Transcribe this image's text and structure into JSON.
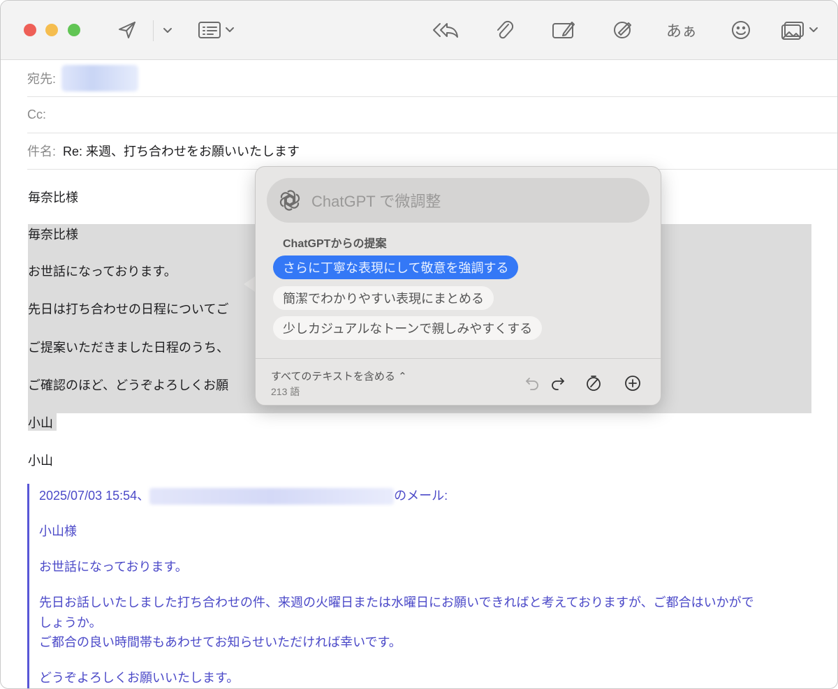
{
  "colors": {
    "accent": "#3478f6",
    "quote": "#4b49c8",
    "close": "#ee5f57",
    "minimize": "#f5bd4f",
    "zoom": "#61c554"
  },
  "toolbar": {
    "icons": [
      "send-icon",
      "send-options-chevron-icon",
      "header-fields-icon",
      "reply-all-icon",
      "attachment-icon",
      "new-message-icon",
      "markup-icon",
      "font-icon",
      "emoji-icon",
      "photo-browser-icon"
    ],
    "font_label": "あぁ"
  },
  "header": {
    "to_label": "宛先:",
    "cc_label": "Cc:",
    "subject_label": "件名:",
    "subject_value": "Re: 来週、打ち合わせをお願いいたします"
  },
  "body": {
    "lines": [
      "毎奈比様",
      "毎奈比様",
      "お世話になっております。",
      "先日は打ち合わせの日程についてご",
      "ご提案いただきました日程のうち、",
      "ご確認のほど、どうぞよろしくお願",
      "小山",
      "小山"
    ]
  },
  "quote": {
    "date_prefix": "2025/07/03 15:54、",
    "date_suffix": "のメール:",
    "lines": [
      "小山様",
      "お世話になっております。",
      "先日お話しいたしました打ち合わせの件、来週の火曜日または水曜日にお願いできればと考えておりますが、ご都合はいかがで",
      "しょうか。",
      "ご都合の良い時間帯もあわせてお知らせいただければ幸いです。",
      "どうぞよろしくお願いいたします。"
    ]
  },
  "chatgpt": {
    "placeholder": "ChatGPT で微調整",
    "suggestions_title": "ChatGPTからの提案",
    "suggestions": [
      "さらに丁寧な表現にして敬意を強調する",
      "簡潔でわかりやすい表現にまとめる",
      "少しカジュアルなトーンで親しみやすくする"
    ],
    "scope_label": "すべてのテキストを含める ⌃",
    "word_count": "213 語"
  }
}
